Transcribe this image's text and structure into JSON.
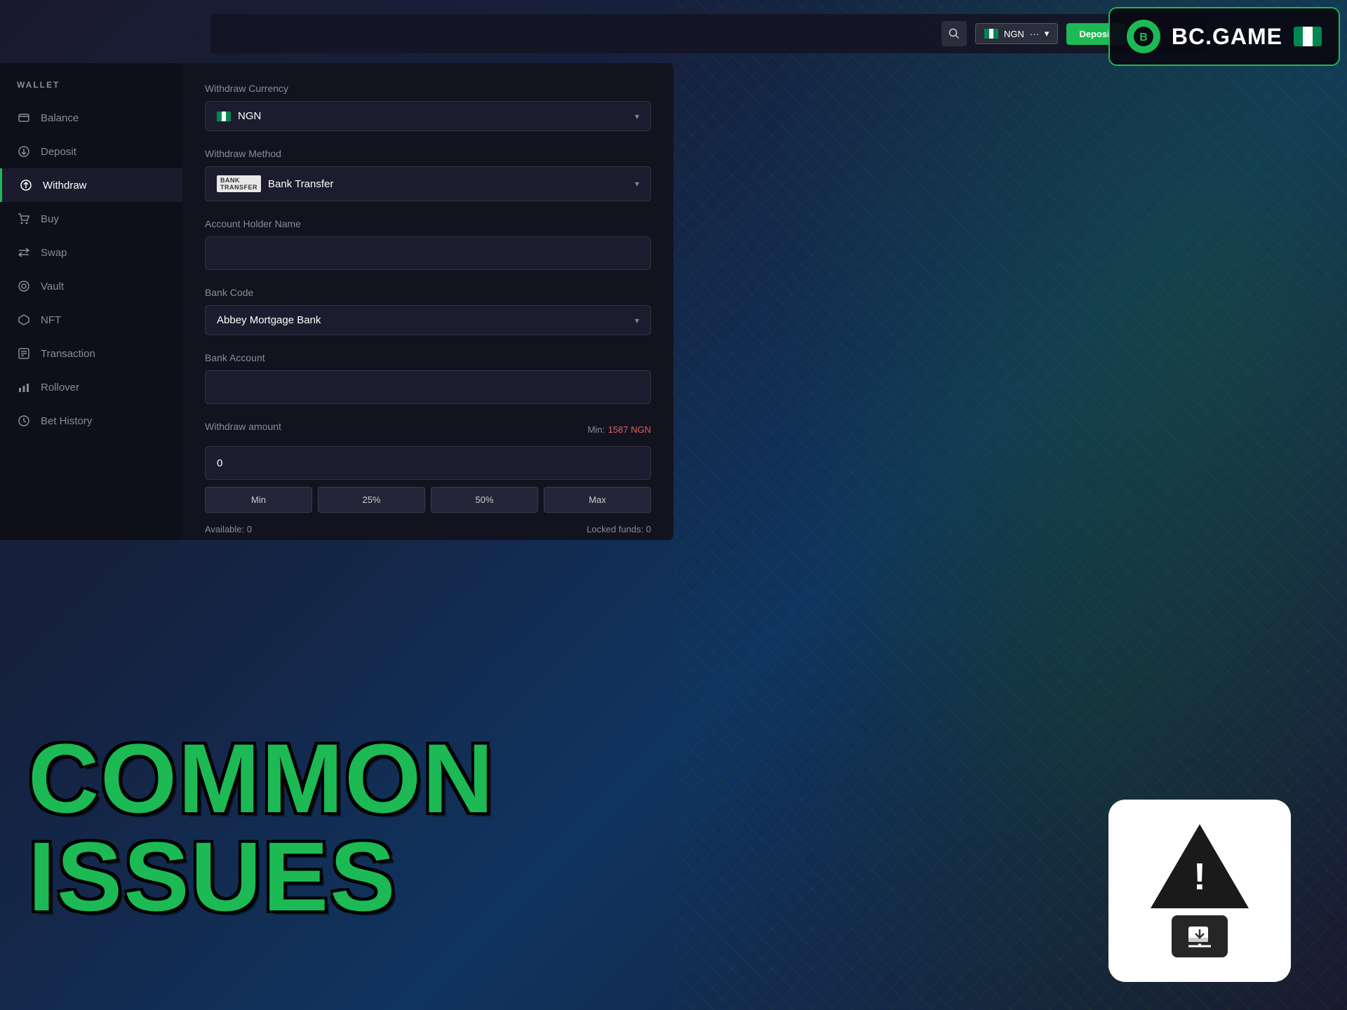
{
  "header": {
    "brand": "BC.GAME",
    "logo_letter": "B",
    "currency": "NGN",
    "deposit_label": "Deposit"
  },
  "topnav": {
    "search_placeholder": "Search",
    "currency_code": "NGN"
  },
  "sidebar": {
    "title": "WALLET",
    "items": [
      {
        "id": "balance",
        "label": "Balance",
        "icon": "⊟"
      },
      {
        "id": "deposit",
        "label": "Deposit",
        "icon": "↓"
      },
      {
        "id": "withdraw",
        "label": "Withdraw",
        "icon": "↑",
        "active": true
      },
      {
        "id": "buy",
        "label": "Buy",
        "icon": "🛒"
      },
      {
        "id": "swap",
        "label": "Swap",
        "icon": "⇄"
      },
      {
        "id": "vault",
        "label": "Vault",
        "icon": "🔒"
      },
      {
        "id": "nft",
        "label": "NFT",
        "icon": "◈"
      },
      {
        "id": "transaction",
        "label": "Transaction",
        "icon": "📋"
      },
      {
        "id": "rollover",
        "label": "Rollover",
        "icon": "📊"
      },
      {
        "id": "bethistory",
        "label": "Bet History",
        "icon": "🕐"
      }
    ]
  },
  "form": {
    "withdraw_currency_label": "Withdraw Currency",
    "currency_selected": "NGN",
    "withdraw_method_label": "Withdraw Method",
    "method_selected": "Bank Transfer",
    "account_holder_label": "Account Holder Name",
    "account_holder_value": "",
    "bank_code_label": "Bank Code",
    "bank_selected": "Abbey Mortgage Bank",
    "bank_account_label": "Bank Account",
    "bank_account_value": "",
    "withdraw_amount_label": "Withdraw amount",
    "min_label": "Min:",
    "min_value": "1587 NGN",
    "amount_value": "0",
    "btn_min": "Min",
    "btn_25": "25%",
    "btn_50": "50%",
    "btn_max": "Max",
    "available_label": "Available:",
    "available_value": "0",
    "locked_label": "Locked funds:",
    "locked_value": "0"
  },
  "overlay": {
    "line1": "COMMON",
    "line2": "ISSUES"
  },
  "warning_icon": {
    "exclamation": "!"
  }
}
